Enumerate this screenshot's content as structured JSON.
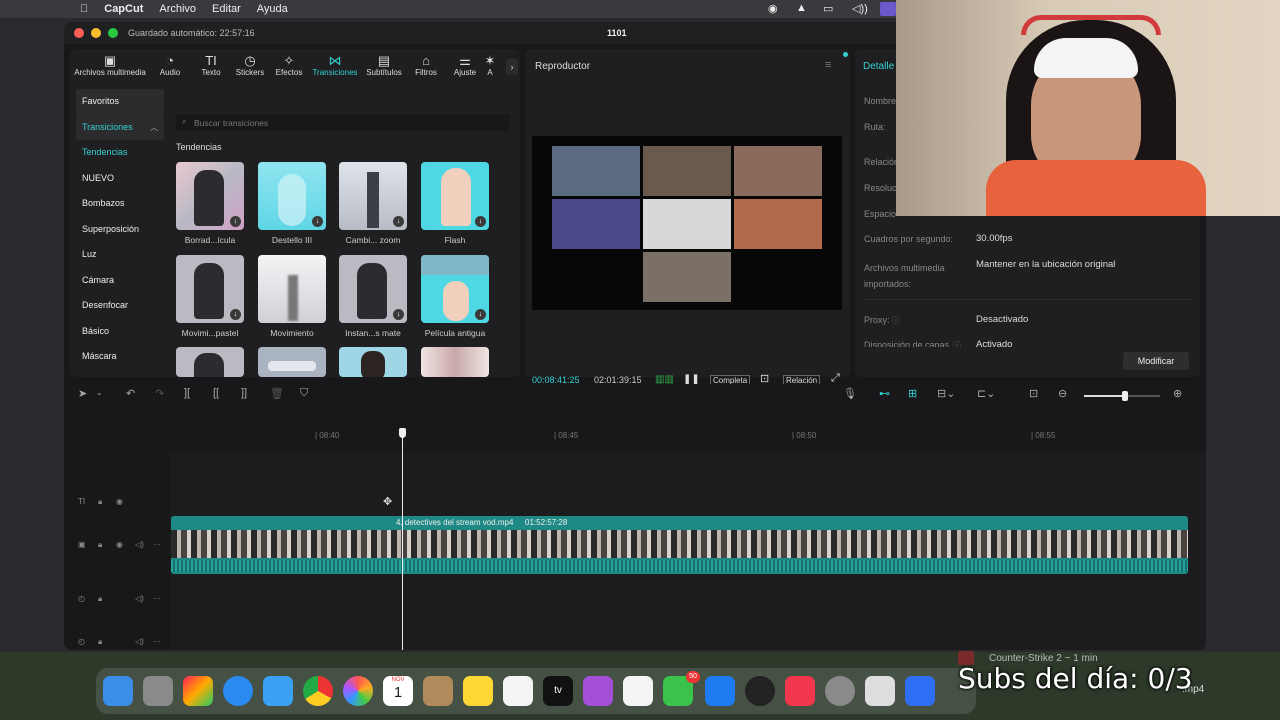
{
  "menubar": {
    "app": "CapCut",
    "items": [
      "Archivo",
      "Editar",
      "Ayuda"
    ]
  },
  "window": {
    "title": "1101",
    "autosave": "Guardado automático: 22:57:16"
  },
  "toolbar": [
    {
      "label": "Archivos multimedia",
      "icon": "media-icon"
    },
    {
      "label": "Audio",
      "icon": "audio-icon"
    },
    {
      "label": "Texto",
      "icon": "text-icon"
    },
    {
      "label": "Stickers",
      "icon": "sticker-icon"
    },
    {
      "label": "Efectos",
      "icon": "effects-icon"
    },
    {
      "label": "Transiciones",
      "icon": "transitions-icon",
      "active": true
    },
    {
      "label": "Subtítulos",
      "icon": "subtitles-icon"
    },
    {
      "label": "Filtros",
      "icon": "filters-icon"
    },
    {
      "label": "Ajuste",
      "icon": "adjust-icon"
    },
    {
      "label": "A",
      "icon": "more-icon"
    }
  ],
  "sidebar": {
    "favorites": "Favoritos",
    "transitions": "Transiciones",
    "categories": [
      "Tendencias",
      "NUEVO",
      "Bombazos",
      "Superposición",
      "Luz",
      "Cámara",
      "Desenfocar",
      "Básico",
      "Máscara"
    ]
  },
  "search": {
    "placeholder": "Buscar transiciones"
  },
  "section_title": "Tendencias",
  "transitions": [
    {
      "label": "Borrad...ícula"
    },
    {
      "label": "Destello III"
    },
    {
      "label": "Cambi... zoom"
    },
    {
      "label": "Flash"
    },
    {
      "label": "Movimi...pastel"
    },
    {
      "label": "Movimiento"
    },
    {
      "label": "Instan...s mate"
    },
    {
      "label": "Película antigua"
    },
    {
      "label": ""
    },
    {
      "label": ""
    },
    {
      "label": ""
    },
    {
      "label": ""
    }
  ],
  "player": {
    "title": "Reproductor",
    "current_time": "00:08:41:25",
    "total_time": "02:01:39:15",
    "full_label": "Completa",
    "ratio_label": "Relación"
  },
  "details": {
    "title": "Detalle",
    "labels": [
      "Nombre",
      "Ruta:",
      "Relación",
      "Resolución",
      "Espacio"
    ],
    "fps_label": "Cuadros por segundo:",
    "fps_value": "30.00fps",
    "imported_label": "Archivos multimedia importados:",
    "imported_value": "Mantener en la ubicación original",
    "proxy_label": "Proxy:",
    "proxy_value": "Desactivado",
    "layers_label": "Disposición de capas",
    "layers_value": "Activado",
    "modify_button": "Modificar"
  },
  "timeline": {
    "ticks": [
      "| 08:40",
      "| 08:45",
      "| 08:50",
      "| 08:55"
    ],
    "clip_name": "4. detectives del stream vod.mp4",
    "clip_duration": "01:52:57:28"
  },
  "overlay": {
    "subs": "Subs del día: 0/3",
    "notification": "Counter-Strike 2 ~ 1 min",
    "file_label": ".mp4"
  },
  "dock": {
    "calendar_month": "NOV",
    "calendar_day": "1",
    "messages_badge": "50"
  },
  "colors": {
    "accent": "#35d0d0",
    "clip": "#1f8a85"
  }
}
